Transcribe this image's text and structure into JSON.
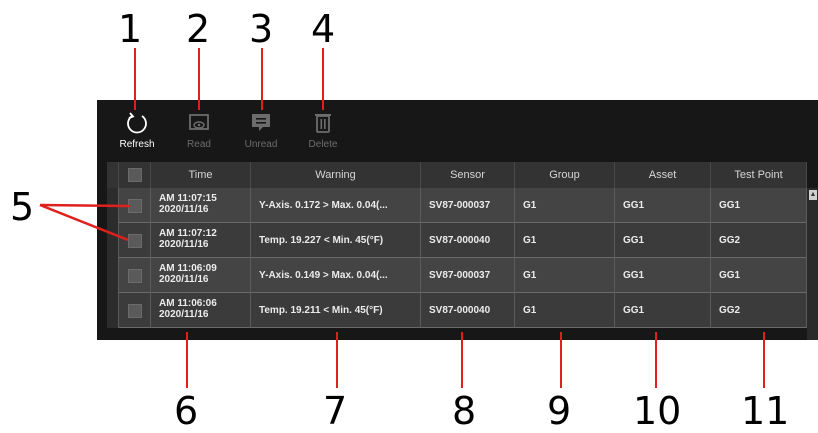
{
  "callouts": [
    "1",
    "2",
    "3",
    "4",
    "5",
    "6",
    "7",
    "8",
    "9",
    "10",
    "11"
  ],
  "toolbar": [
    {
      "label": "Refresh",
      "icon": "refresh-icon",
      "enabled": true
    },
    {
      "label": "Read",
      "icon": "read-icon",
      "enabled": false
    },
    {
      "label": "Unread",
      "icon": "unread-icon",
      "enabled": false
    },
    {
      "label": "Delete",
      "icon": "delete-icon",
      "enabled": false
    }
  ],
  "table": {
    "columns": [
      "Time",
      "Warning",
      "Sensor",
      "Group",
      "Asset",
      "Test Point"
    ],
    "rows": [
      {
        "time": "AM 11:07:15",
        "date": "2020/11/16",
        "warning": "Y-Axis. 0.172 > Max. 0.04(...",
        "sensor": "SV87-000037",
        "group": "G1",
        "asset": "GG1",
        "test_point": "GG1"
      },
      {
        "time": "AM 11:07:12",
        "date": "2020/11/16",
        "warning": "Temp. 19.227 < Min. 45(°F)",
        "sensor": "SV87-000040",
        "group": "G1",
        "asset": "GG1",
        "test_point": "GG2"
      },
      {
        "time": "AM 11:06:09",
        "date": "2020/11/16",
        "warning": "Y-Axis. 0.149 > Max. 0.04(...",
        "sensor": "SV87-000037",
        "group": "G1",
        "asset": "GG1",
        "test_point": "GG1"
      },
      {
        "time": "AM 11:06:06",
        "date": "2020/11/16",
        "warning": "Temp. 19.211 < Min. 45(°F)",
        "sensor": "SV87-000040",
        "group": "G1",
        "asset": "GG1",
        "test_point": "GG2"
      }
    ]
  },
  "colors": {
    "app_bg": "#171717",
    "header_bg": "#333333",
    "row_bg": "#444444",
    "callout_line": "#e0201c"
  }
}
